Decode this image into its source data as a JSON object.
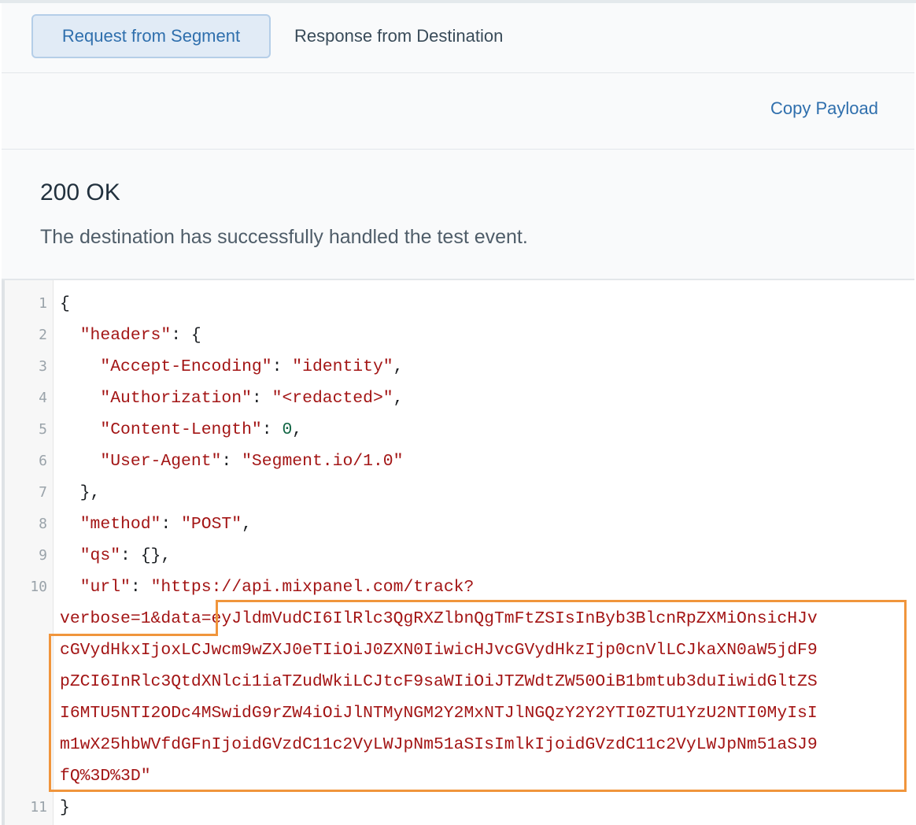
{
  "tabs": [
    {
      "label": "Request from Segment",
      "active": true
    },
    {
      "label": "Response from Destination",
      "active": false
    }
  ],
  "toolbar": {
    "copy_label": "Copy Payload"
  },
  "status": {
    "code": "200 OK",
    "message": "The destination has successfully handled the test event."
  },
  "code": {
    "line_numbers": [
      "1",
      "2",
      "3",
      "4",
      "5",
      "6",
      "7",
      "8",
      "9",
      "10",
      "11"
    ],
    "lines": [
      {
        "parts": [
          {
            "t": "{",
            "c": "p"
          }
        ]
      },
      {
        "parts": [
          {
            "t": "  ",
            "c": "p"
          },
          {
            "t": "\"headers\"",
            "c": "k"
          },
          {
            "t": ": {",
            "c": "p"
          }
        ]
      },
      {
        "parts": [
          {
            "t": "    ",
            "c": "p"
          },
          {
            "t": "\"Accept-Encoding\"",
            "c": "k"
          },
          {
            "t": ": ",
            "c": "p"
          },
          {
            "t": "\"identity\"",
            "c": "s"
          },
          {
            "t": ",",
            "c": "p"
          }
        ]
      },
      {
        "parts": [
          {
            "t": "    ",
            "c": "p"
          },
          {
            "t": "\"Authorization\"",
            "c": "k"
          },
          {
            "t": ": ",
            "c": "p"
          },
          {
            "t": "\"<redacted>\"",
            "c": "s"
          },
          {
            "t": ",",
            "c": "p"
          }
        ]
      },
      {
        "parts": [
          {
            "t": "    ",
            "c": "p"
          },
          {
            "t": "\"Content-Length\"",
            "c": "k"
          },
          {
            "t": ": ",
            "c": "p"
          },
          {
            "t": "0",
            "c": "n"
          },
          {
            "t": ",",
            "c": "p"
          }
        ]
      },
      {
        "parts": [
          {
            "t": "    ",
            "c": "p"
          },
          {
            "t": "\"User-Agent\"",
            "c": "k"
          },
          {
            "t": ": ",
            "c": "p"
          },
          {
            "t": "\"Segment.io/1.0\"",
            "c": "s"
          }
        ]
      },
      {
        "parts": [
          {
            "t": "  },",
            "c": "p"
          }
        ]
      },
      {
        "parts": [
          {
            "t": "  ",
            "c": "p"
          },
          {
            "t": "\"method\"",
            "c": "k"
          },
          {
            "t": ": ",
            "c": "p"
          },
          {
            "t": "\"POST\"",
            "c": "s"
          },
          {
            "t": ",",
            "c": "p"
          }
        ]
      },
      {
        "parts": [
          {
            "t": "  ",
            "c": "p"
          },
          {
            "t": "\"qs\"",
            "c": "k"
          },
          {
            "t": ": {},",
            "c": "p"
          }
        ]
      },
      {
        "parts": [
          {
            "t": "  ",
            "c": "p"
          },
          {
            "t": "\"url\"",
            "c": "k"
          },
          {
            "t": ": ",
            "c": "p"
          },
          {
            "t": "\"https://api.mixpanel.com/track?",
            "c": "s"
          }
        ]
      },
      {
        "parts": [
          {
            "t": "verbose=1&data=eyJldmVudCI6IlRlc3QgRXZlbnQgTmFtZSIsInByb3BlcnRpZXMiOnsicHJv",
            "c": "s"
          }
        ]
      },
      {
        "parts": [
          {
            "t": "cGVydHkxIjoxLCJwcm9wZXJ0eTIiOiJ0ZXN0IiwicHJvcGVydHkzIjp0cnVlLCJkaXN0aW5jdF9",
            "c": "s"
          }
        ]
      },
      {
        "parts": [
          {
            "t": "pZCI6InRlc3QtdXNlci1iaTZudWkiLCJtcF9saWIiOiJTZWdtZW50OiB1bmtub3duIiwidGltZS",
            "c": "s"
          }
        ]
      },
      {
        "parts": [
          {
            "t": "I6MTU5NTI2ODc4MSwidG9rZW4iOiJlNTMyNGM2Y2MxNTJlNGQzY2Y2YTI0ZTU1YzU2NTI0MyIsI",
            "c": "s"
          }
        ]
      },
      {
        "parts": [
          {
            "t": "m1wX25hbWVfdGFnIjoidGVzdC11c2VyLWJpNm51aSIsImlkIjoidGVzdC11c2VyLWJpNm51aSJ9",
            "c": "s"
          }
        ]
      },
      {
        "parts": [
          {
            "t": "fQ%3D%3D\"",
            "c": "s"
          }
        ]
      },
      {
        "parts": [
          {
            "t": "}",
            "c": "p"
          }
        ]
      }
    ]
  },
  "colors": {
    "accent": "#2f6fad",
    "highlight": "#f0953c",
    "string": "#a31515",
    "number": "#116644"
  }
}
